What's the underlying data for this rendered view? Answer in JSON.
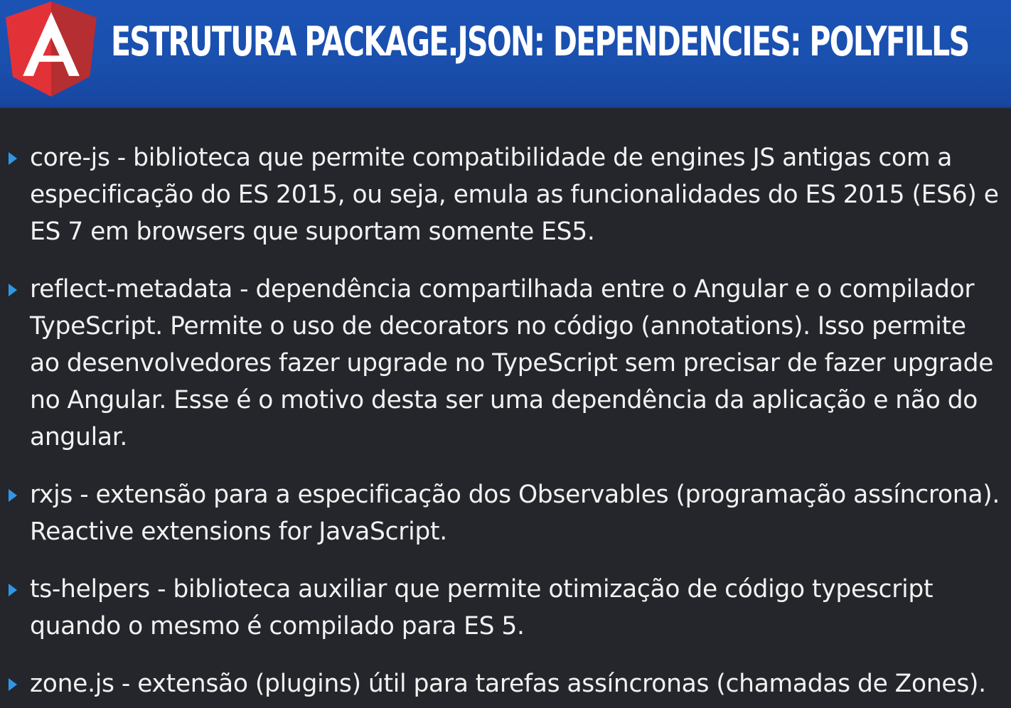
{
  "header": {
    "title": "ESTRUTURA PACKAGE.JSON: DEPENDENCIES: POLYFILLS",
    "logo_icon": "angular-logo-icon",
    "background_color": "#1b53b5",
    "logo_colors": {
      "left": "#e23237",
      "right": "#b52e31",
      "letter": "#ffffff"
    }
  },
  "bullets": [
    {
      "text": "core-js - biblioteca que permite compatibilidade de engines JS antigas com a especificação do ES 2015, ou seja, emula as funcionalidades do ES 2015 (ES6) e ES 7 em browsers que suportam somente ES5."
    },
    {
      "text": "reflect-metadata - dependência compartilhada entre o Angular e o compilador TypeScript. Permite o uso de decorators no código (annotations). Isso permite ao desenvolvedores fazer upgrade no TypeScript sem precisar de fazer upgrade no Angular. Esse é o motivo desta ser uma dependência da aplicação e não do angular."
    },
    {
      "text": "rxjs - extensão para a especificação dos Observables (programação assíncrona). Reactive extensions for JavaScript."
    },
    {
      "text": "ts-helpers - biblioteca auxiliar que permite otimização de código typescript quando o mesmo é compilado para ES 5."
    },
    {
      "text": "zone.js - extensão (plugins) útil para tarefas assíncronas (chamadas de Zones)."
    }
  ],
  "colors": {
    "background": "#24262b",
    "text": "#f2f2f2",
    "bullet_marker": "#2f97e8"
  }
}
